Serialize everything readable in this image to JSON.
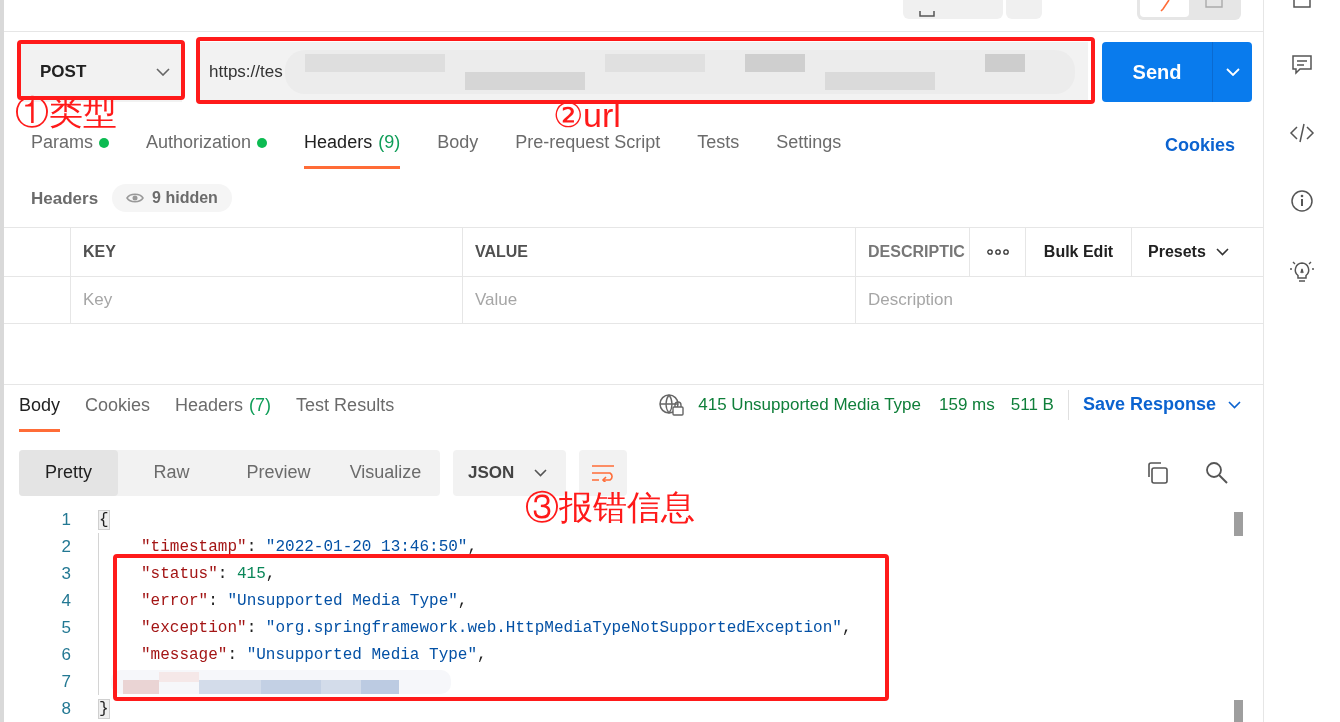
{
  "request": {
    "method": "POST",
    "url": "https://tes"
  },
  "send_button": "Send",
  "request_tabs": [
    {
      "label": "Params",
      "dot": true,
      "selected": false
    },
    {
      "label": "Authorization",
      "dot": true,
      "selected": false
    },
    {
      "label": "Headers",
      "count": "(9)",
      "dot": false,
      "selected": true
    },
    {
      "label": "Body",
      "dot": false,
      "selected": false
    },
    {
      "label": "Pre-request Script",
      "dot": false,
      "selected": false
    },
    {
      "label": "Tests",
      "dot": false,
      "selected": false
    },
    {
      "label": "Settings",
      "dot": false,
      "selected": false
    }
  ],
  "cookies_link": "Cookies",
  "headers_section": {
    "title": "Headers",
    "hidden_chip": "9 hidden"
  },
  "headers_table": {
    "columns": [
      "KEY",
      "VALUE",
      "DESCRIPTIC"
    ],
    "bulk_edit": "Bulk Edit",
    "presets": "Presets",
    "placeholders": [
      "Key",
      "Value",
      "Description"
    ]
  },
  "response": {
    "tabs": [
      {
        "label": "Body",
        "selected": true
      },
      {
        "label": "Cookies",
        "selected": false
      },
      {
        "label": "Headers",
        "count": "(7)",
        "selected": false
      },
      {
        "label": "Test Results",
        "selected": false
      }
    ],
    "status": "415 Unsupported Media Type",
    "time": "159 ms",
    "size": "511 B",
    "save": "Save Response"
  },
  "view_modes": [
    {
      "label": "Pretty",
      "selected": true
    },
    {
      "label": "Raw",
      "selected": false
    },
    {
      "label": "Preview",
      "selected": false
    },
    {
      "label": "Visualize",
      "selected": false
    }
  ],
  "format": "JSON",
  "code_lines": [
    {
      "number": "1",
      "tokens": [
        {
          "kind": "brace",
          "text": "{"
        }
      ],
      "children": [
        {
          "number": "2",
          "tokens": [
            {
              "kind": "key",
              "text": "\"timestamp\""
            },
            {
              "kind": "punct",
              "text": ": "
            },
            {
              "kind": "string",
              "text": "\"2022-01-20 13:46:50\""
            },
            {
              "kind": "punct",
              "text": ","
            }
          ]
        },
        {
          "number": "3",
          "tokens": [
            {
              "kind": "key",
              "text": "\"status\""
            },
            {
              "kind": "punct",
              "text": ": "
            },
            {
              "kind": "number",
              "text": "415"
            },
            {
              "kind": "punct",
              "text": ","
            }
          ]
        },
        {
          "number": "4",
          "tokens": [
            {
              "kind": "key",
              "text": "\"error\""
            },
            {
              "kind": "punct",
              "text": ": "
            },
            {
              "kind": "string",
              "text": "\"Unsupported Media Type\""
            },
            {
              "kind": "punct",
              "text": ","
            }
          ]
        },
        {
          "number": "5",
          "tokens": [
            {
              "kind": "key",
              "text": "\"exception\""
            },
            {
              "kind": "punct",
              "text": ": "
            },
            {
              "kind": "string",
              "text": "\"org.springframework.web.HttpMediaTypeNotSupportedException\""
            },
            {
              "kind": "punct",
              "text": ","
            }
          ]
        },
        {
          "number": "6",
          "tokens": [
            {
              "kind": "key",
              "text": "\"message\""
            },
            {
              "kind": "punct",
              "text": ": "
            },
            {
              "kind": "string",
              "text": "\"Unsupported Media Type\""
            },
            {
              "kind": "punct",
              "text": ","
            }
          ]
        },
        {
          "number": "7",
          "tokens": [
            {
              "kind": "blurred"
            }
          ]
        }
      ]
    },
    {
      "number": "8",
      "tokens": [
        {
          "kind": "brace",
          "text": "}"
        }
      ]
    }
  ],
  "annotations": [
    {
      "label": "①类型"
    },
    {
      "label": "②url"
    },
    {
      "label": "③报错信息"
    }
  ]
}
